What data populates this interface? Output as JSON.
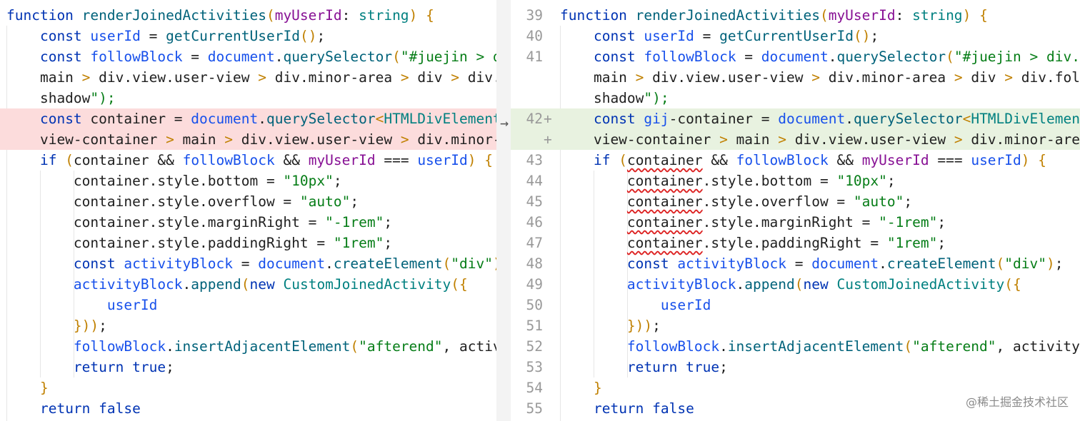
{
  "left_lines": [
    "function renderJoinedActivities(myUserId: string) {",
    "    const userId = getCurrentUserId();",
    "    const followBlock = document.querySelector(\"#juejin > d",
    "    main > div.view.user-view > div.minor-area > div > div.",
    "    shadow\");",
    "    const container = document.querySelector<HTMLDivElement>",
    "    view-container > main > div.view.user-view > div.minor-a",
    "    if (container && followBlock && myUserId === userId) {",
    "        container.style.bottom = \"10px\";",
    "        container.style.overflow = \"auto\";",
    "        container.style.marginRight = \"-1rem\";",
    "        container.style.paddingRight = \"1rem\";",
    "        const activityBlock = document.createElement(\"div\")",
    "        activityBlock.append(new CustomJoinedActivity({",
    "            userId",
    "        }));",
    "        followBlock.insertAdjacentElement(\"afterend\", activ",
    "        return true;",
    "    }",
    "    return false"
  ],
  "right_lines": [
    "function renderJoinedActivities(myUserId: string) {",
    "    const userId = getCurrentUserId();",
    "    const followBlock = document.querySelector(\"#juejin > div.v",
    "    main > div.view.user-view > div.minor-area > div > div.foll",
    "    shadow\");",
    "    const gij-container = document.querySelector<HTMLDivElement",
    "    view-container > main > div.view.user-view > div.minor-area",
    "    if (container && followBlock && myUserId === userId) {",
    "        container.style.bottom = \"10px\";",
    "        container.style.overflow = \"auto\";",
    "        container.style.marginRight = \"-1rem\";",
    "        container.style.paddingRight = \"1rem\";",
    "        const activityBlock = document.createElement(\"div\");",
    "        activityBlock.append(new CustomJoinedActivity({",
    "            userId",
    "        }));",
    "        followBlock.insertAdjacentElement(\"afterend\", activityB",
    "        return true;",
    "    }",
    "    return false"
  ],
  "line_numbers": [
    "39",
    "40",
    "41",
    "",
    "",
    "42",
    "",
    "43",
    "44",
    "45",
    "46",
    "47",
    "48",
    "49",
    "50",
    "51",
    "52",
    "53",
    "54",
    "55"
  ],
  "gutter_marks": [
    "",
    "",
    "",
    "",
    "",
    "+",
    "+",
    "",
    "",
    "",
    "",
    "",
    "",
    "",
    "",
    "",
    "",
    "",
    "",
    ""
  ],
  "change_arrow": "→",
  "watermark": "@稀土掘金技术社区",
  "colors": {
    "deleted_bg": "#fcdcdc",
    "added_bg": "#e8f2e0",
    "keyword": "#0033b3",
    "string": "#067d17"
  }
}
